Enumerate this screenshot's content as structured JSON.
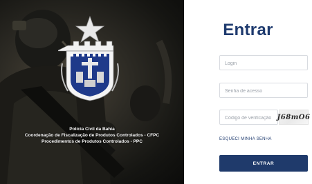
{
  "caption": {
    "line1": "Polícia Civil da Bahia",
    "line2": "Coordenação de Fiscalização de Produtos Controlados - CFPC",
    "line3": "Procedimentos de Produtos Controlados - PPC"
  },
  "form": {
    "title": "Entrar",
    "login_placeholder": "Login",
    "senha_placeholder": "Senha de acesso",
    "captcha_placeholder": "Código de verificação",
    "captcha_text": "J68mO6",
    "forgot_label": "ESQUECI MINHA SENHA",
    "submit_label": "ENTRAR"
  },
  "colors": {
    "primary": "#1f3a6b",
    "title": "#1e3a6e",
    "emblem_blue": "#1f3a8a"
  },
  "icons": {
    "emblem": "police-emblem-icon",
    "star": "star-icon"
  }
}
